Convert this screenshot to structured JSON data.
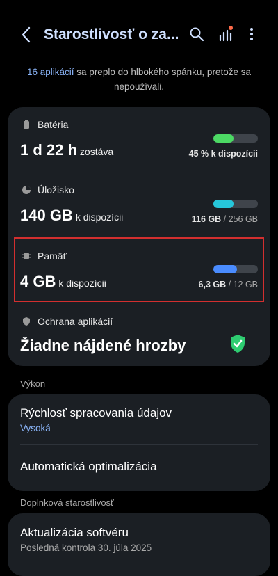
{
  "header": {
    "title": "Starostlivosť o za...",
    "back_icon": "chevron-left-icon",
    "search_icon": "search-icon",
    "stats_icon": "bar-chart-icon",
    "more_icon": "more-vertical-icon"
  },
  "notice": {
    "link_text": "16 aplikácií",
    "rest_text": " sa preplo do hlbokého spánku, pretože sa nepoužívali."
  },
  "battery": {
    "label": "Batéria",
    "value": "1 d 22 h",
    "unit": "zostáva",
    "percent_caption": "45 % k dispozícii",
    "level": 0.45,
    "color": "#4cd964"
  },
  "storage": {
    "label": "Úložisko",
    "value": "140 GB",
    "unit": "k dispozícii",
    "used": "116 GB",
    "separator": " / ",
    "total": "256 GB",
    "level": 0.45,
    "color": "#26c6da"
  },
  "memory": {
    "label": "Pamäť",
    "value": "4 GB",
    "unit": "k dispozícii",
    "used": "6,3 GB",
    "separator": " / ",
    "total": "12 GB",
    "level": 0.53,
    "color": "#4a8cff"
  },
  "protection": {
    "label": "Ochrana aplikácií",
    "status": "Žiadne nájdené hrozby",
    "shield_color": "#2ecc71"
  },
  "performance": {
    "section_title": "Výkon",
    "speed_title": "Rýchlosť spracovania údajov",
    "speed_value": "Vysoká",
    "auto_title": "Automatická optimalizácia"
  },
  "extra": {
    "section_title": "Doplnková starostlivosť",
    "update_title": "Aktualizácia softvéru",
    "update_sub": "Posledná kontrola 30. júla 2025"
  },
  "colors": {
    "accent": "#8ab4f8",
    "card": "#1b1f24",
    "highlight": "#d32f2f"
  }
}
